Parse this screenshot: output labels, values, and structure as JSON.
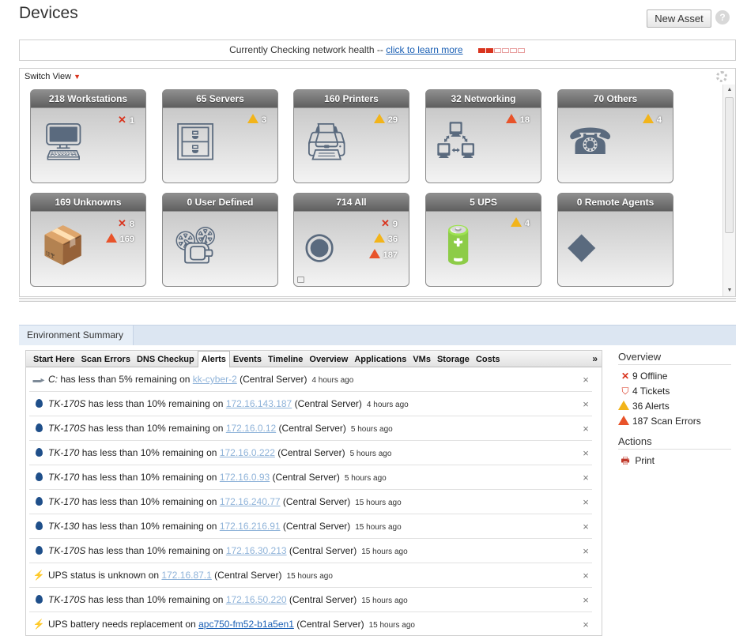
{
  "page": {
    "title": "Devices",
    "new_asset_label": "New Asset",
    "help_label": "?"
  },
  "health": {
    "text": "Currently Checking network health -- ",
    "link": "click to learn more",
    "meter_on": 2,
    "meter_total": 6
  },
  "devices": {
    "switch_view_label": "Switch View",
    "tiles": [
      {
        "label": "218 Workstations",
        "badges": [
          {
            "kind": "offline",
            "count": "1"
          }
        ]
      },
      {
        "label": "65 Servers",
        "badges": [
          {
            "kind": "warning",
            "count": "3"
          }
        ]
      },
      {
        "label": "160 Printers",
        "badges": [
          {
            "kind": "warning",
            "count": "29"
          }
        ]
      },
      {
        "label": "32 Networking",
        "badges": [
          {
            "kind": "error",
            "count": "18"
          }
        ]
      },
      {
        "label": "70 Others",
        "badges": [
          {
            "kind": "warning",
            "count": "4"
          }
        ]
      },
      {
        "label": "169 Unknowns",
        "badges": [
          {
            "kind": "offline",
            "count": "8"
          },
          {
            "kind": "error",
            "count": "169"
          }
        ]
      },
      {
        "label": "0 User Defined",
        "badges": []
      },
      {
        "label": "714 All",
        "badges": [
          {
            "kind": "offline",
            "count": "9"
          },
          {
            "kind": "warning",
            "count": "36"
          },
          {
            "kind": "error",
            "count": "187"
          }
        ]
      },
      {
        "label": "5 UPS",
        "badges": [
          {
            "kind": "warning",
            "count": "4"
          }
        ]
      },
      {
        "label": "0 Remote Agents",
        "badges": []
      }
    ]
  },
  "environment": {
    "title": "Environment Summary",
    "tabs": [
      "Start Here",
      "Scan Errors",
      "DNS Checkup",
      "Alerts",
      "Events",
      "Timeline",
      "Overview",
      "Applications",
      "VMs",
      "Storage",
      "Costs"
    ],
    "active_tab": "Alerts",
    "more_label": "»",
    "alerts": [
      {
        "icon": "car",
        "item": "C:",
        "text": " has less than 5% remaining on ",
        "host": "kk-cyber-2",
        "suffix": " (Central Server)",
        "time": "4 hours ago"
      },
      {
        "icon": "drop",
        "item": "TK-170S",
        "text": " has less than 10% remaining on ",
        "host": "172.16.143.187",
        "suffix": " (Central Server)",
        "time": "4 hours ago"
      },
      {
        "icon": "drop",
        "item": "TK-170S",
        "text": " has less than 10% remaining on ",
        "host": "172.16.0.12",
        "suffix": " (Central Server)",
        "time": "5 hours ago"
      },
      {
        "icon": "drop",
        "item": "TK-170",
        "text": " has less than 10% remaining on ",
        "host": "172.16.0.222",
        "suffix": " (Central Server)",
        "time": "5 hours ago"
      },
      {
        "icon": "drop",
        "item": "TK-170",
        "text": " has less than 10% remaining on ",
        "host": "172.16.0.93",
        "suffix": " (Central Server)",
        "time": "5 hours ago"
      },
      {
        "icon": "drop",
        "item": "TK-170",
        "text": " has less than 10% remaining on ",
        "host": "172.16.240.77",
        "suffix": " (Central Server)",
        "time": "15 hours ago"
      },
      {
        "icon": "drop",
        "item": "TK-130",
        "text": " has less than 10% remaining on ",
        "host": "172.16.216.91",
        "suffix": " (Central Server)",
        "time": "15 hours ago"
      },
      {
        "icon": "drop",
        "item": "TK-170S",
        "text": " has less than 10% remaining on ",
        "host": "172.16.30.213",
        "suffix": " (Central Server)",
        "time": "15 hours ago"
      },
      {
        "icon": "ups",
        "item": "",
        "text": "UPS status is unknown on ",
        "host": "172.16.87.1",
        "suffix": " (Central Server)",
        "time": "15 hours ago"
      },
      {
        "icon": "drop",
        "item": "TK-170S",
        "text": " has less than 10% remaining on ",
        "host": "172.16.50.220",
        "suffix": " (Central Server)",
        "time": "15 hours ago"
      },
      {
        "icon": "ups",
        "item": "",
        "text": "UPS battery needs replacement on ",
        "host": "apc750-fm52-b1a5en1",
        "suffix": " (Central Server)",
        "time": "15 hours ago"
      }
    ],
    "close_label": "×"
  },
  "overview": {
    "title": "Overview",
    "items": [
      {
        "icon": "offline",
        "label": "9 Offline"
      },
      {
        "icon": "ticket",
        "label": "4 Tickets"
      },
      {
        "icon": "warning",
        "label": "36 Alerts"
      },
      {
        "icon": "error",
        "label": "187 Scan Errors"
      }
    ],
    "actions_title": "Actions",
    "print_label": "Print"
  },
  "colors": {
    "accent_red": "#d9341e",
    "warning_yellow": "#f2b41a",
    "error_orange": "#e8532a",
    "link_blue": "#1a5fb4",
    "tab_bar_blue": "#dce6f2"
  }
}
